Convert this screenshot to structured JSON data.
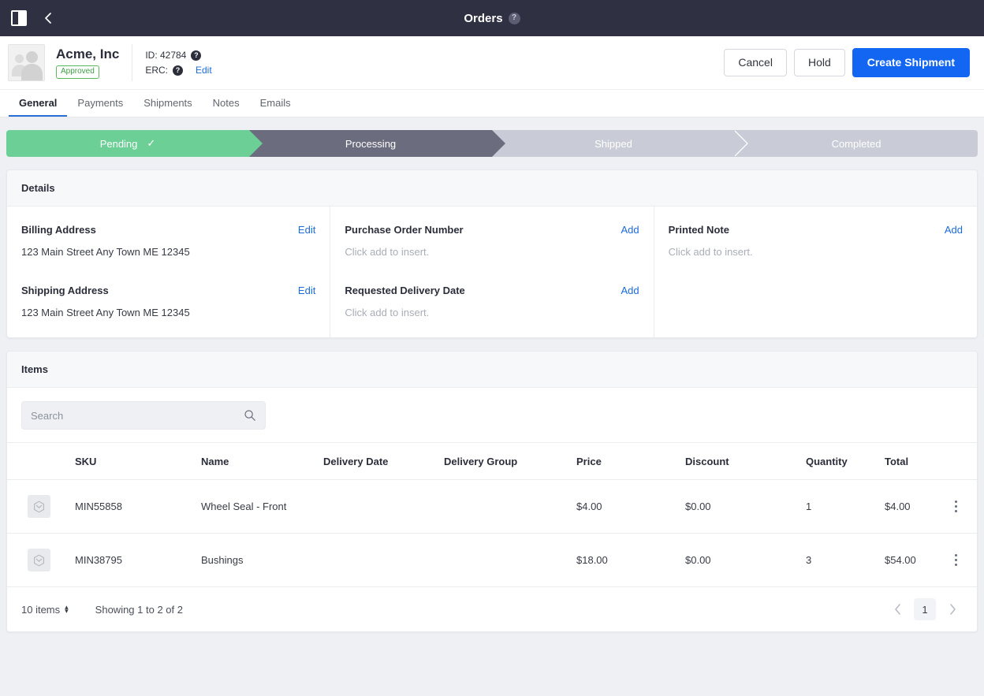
{
  "topbar": {
    "title": "Orders",
    "help_icon": "help-circle-icon",
    "panel_toggle_icon": "panel-toggle-icon",
    "back_icon": "chevron-left-icon"
  },
  "record": {
    "company": "Acme, Inc",
    "status": "Approved",
    "id_label": "ID: 42784",
    "erc_label": "ERC:",
    "edit_link": "Edit",
    "actions": {
      "cancel": "Cancel",
      "hold": "Hold",
      "create_shipment": "Create Shipment"
    }
  },
  "tabs": [
    {
      "label": "General",
      "active": true
    },
    {
      "label": "Payments",
      "active": false
    },
    {
      "label": "Shipments",
      "active": false
    },
    {
      "label": "Notes",
      "active": false
    },
    {
      "label": "Emails",
      "active": false
    }
  ],
  "stepper": {
    "steps": [
      {
        "label": "Pending",
        "state": "done",
        "tick": "✓"
      },
      {
        "label": "Processing",
        "state": "current",
        "tick": ""
      },
      {
        "label": "Shipped",
        "state": "todo",
        "tick": ""
      },
      {
        "label": "Completed",
        "state": "todo",
        "tick": ""
      }
    ],
    "colors": {
      "done": "#6cd096",
      "current": "#6b6c7e",
      "todo": "#c9cbd6"
    }
  },
  "details": {
    "title": "Details",
    "columns": [
      {
        "fields": [
          {
            "label": "Billing Address",
            "action": "Edit",
            "value": "123 Main Street Any Town ME 12345",
            "empty": false
          },
          {
            "label": "Shipping Address",
            "action": "Edit",
            "value": "123 Main Street Any Town ME 12345",
            "empty": false
          }
        ]
      },
      {
        "fields": [
          {
            "label": "Purchase Order Number",
            "action": "Add",
            "value": "Click add to insert.",
            "empty": true
          },
          {
            "label": "Requested Delivery Date",
            "action": "Add",
            "value": "Click add to insert.",
            "empty": true
          }
        ]
      },
      {
        "fields": [
          {
            "label": "Printed Note",
            "action": "Add",
            "value": "Click add to insert.",
            "empty": true
          }
        ]
      }
    ]
  },
  "items": {
    "title": "Items",
    "search": {
      "value": "",
      "placeholder": "Search",
      "icon": "search-icon"
    },
    "columns": [
      "",
      "SKU",
      "Name",
      "Delivery Date",
      "Delivery Group",
      "Price",
      "Discount",
      "Quantity",
      "Total",
      ""
    ],
    "rows": [
      {
        "thumb_icon": "package-icon",
        "sku": "MIN55858",
        "name": "Wheel Seal - Front",
        "delivery_date": "",
        "delivery_group": "",
        "price": "$4.00",
        "discount": "$0.00",
        "quantity": "1",
        "total": "$4.00",
        "menu_icon": "kebab-menu-icon"
      },
      {
        "thumb_icon": "package-icon",
        "sku": "MIN38795",
        "name": "Bushings",
        "delivery_date": "",
        "delivery_group": "",
        "price": "$18.00",
        "discount": "$0.00",
        "quantity": "3",
        "total": "$54.00",
        "menu_icon": "kebab-menu-icon"
      }
    ],
    "footer": {
      "per_page": "10 items",
      "showing": "Showing 1 to 2 of 2",
      "page_current": "1",
      "prev_icon": "chevron-left-icon",
      "next_icon": "chevron-right-icon"
    }
  },
  "colors": {
    "primary": "#1366f2",
    "link": "#1a6bdc",
    "topbar_bg": "#2f3142",
    "page_bg": "#eef0f4",
    "status_green": "#5cb85c"
  }
}
